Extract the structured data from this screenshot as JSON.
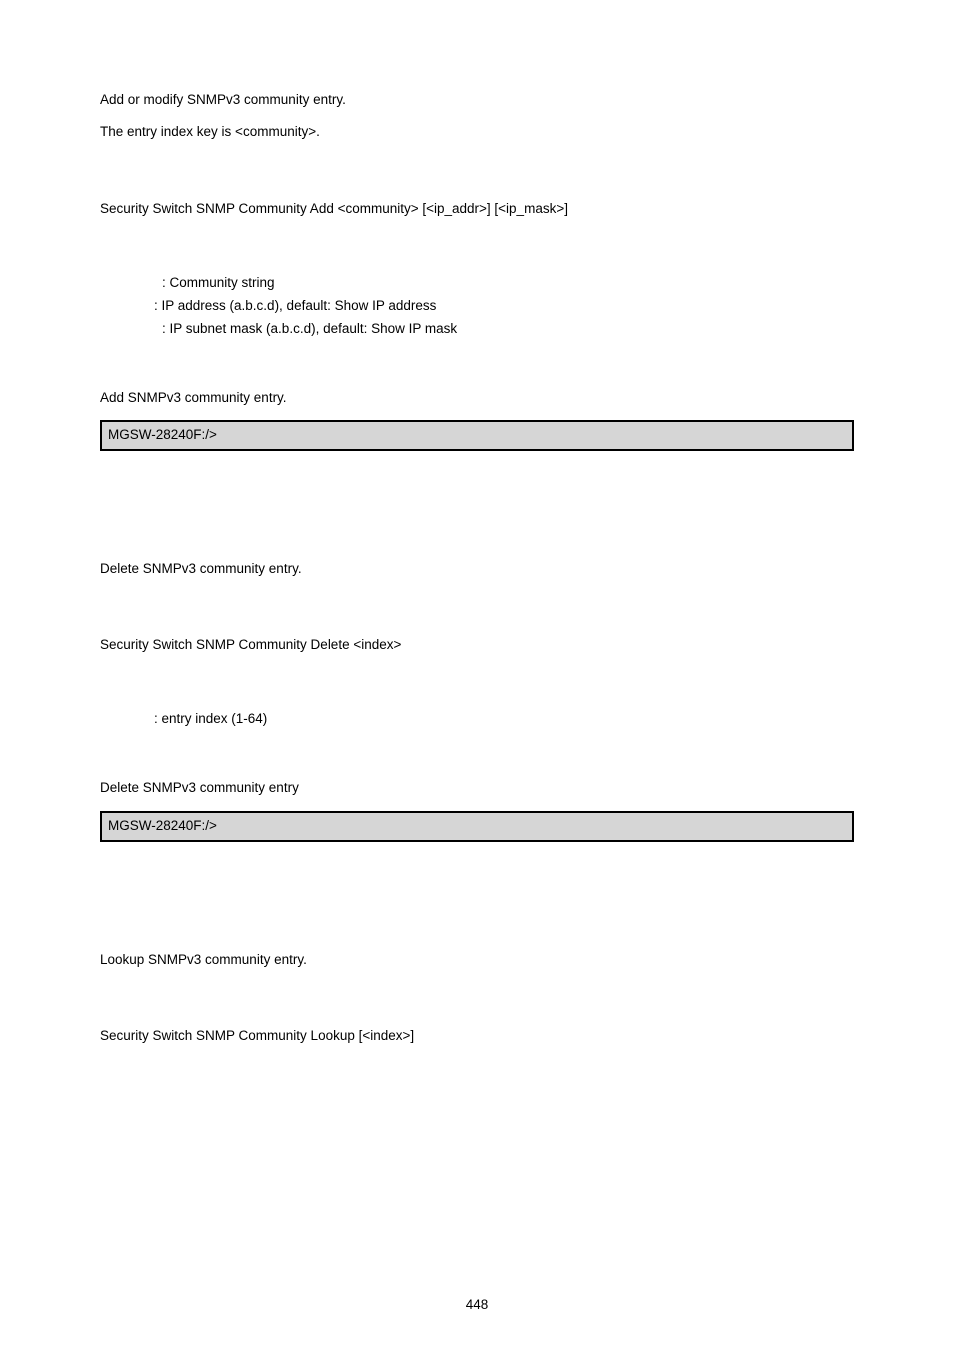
{
  "section1": {
    "desc1": "Add or modify SNMPv3 community entry.",
    "desc2": "The entry index key is <community>.",
    "syntax": "Security Switch SNMP Community Add <community> [<ip_addr>] [<ip_mask>]",
    "params": {
      "p1": " : Community string",
      "p2": ": IP address (a.b.c.d), default: Show IP address",
      "p3": " : IP subnet mask (a.b.c.d), default: Show IP mask"
    },
    "example_label": "Add SNMPv3 community entry.",
    "code": "MGSW-28240F:/>"
  },
  "section2": {
    "desc": "Delete SNMPv3 community entry.",
    "syntax": "Security Switch SNMP Community Delete <index>",
    "param": ": entry index (1-64)",
    "example_label": "Delete SNMPv3 community entry",
    "code": "MGSW-28240F:/>"
  },
  "section3": {
    "desc": "Lookup SNMPv3 community entry.",
    "syntax": "Security Switch SNMP Community Lookup [<index>]"
  },
  "pageNumber": "448"
}
